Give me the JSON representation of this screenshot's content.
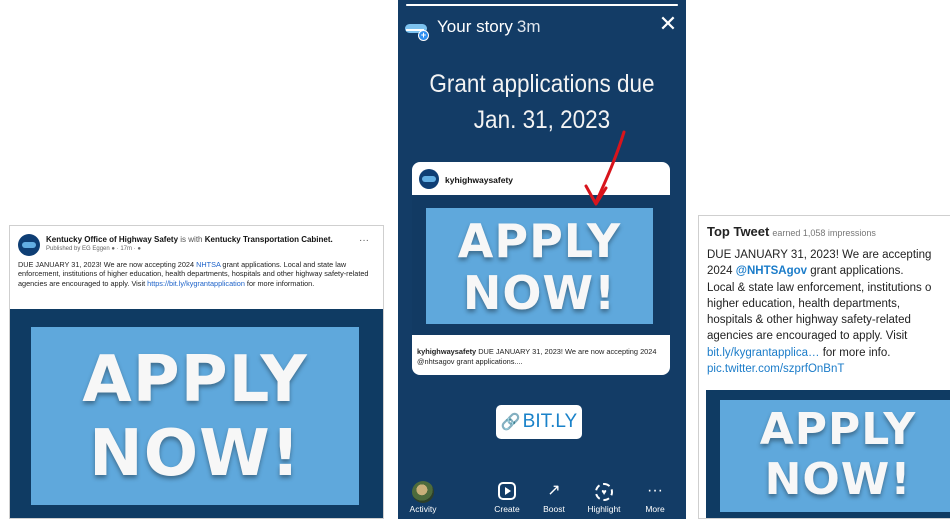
{
  "facebook_post": {
    "page_name": "Kentucky Office of Highway Safety",
    "with_text": "is with",
    "tagged": "Kentucky Transportation Cabinet.",
    "meta": "Published by EG Eggen ● · 17m · ●",
    "more": "···",
    "body_start": "DUE JANUARY 31, 2023! We are now accepting 2024 ",
    "body_link": "NHTSA",
    "body_mid": " grant applications.  Local and state law enforcement, institutions of higher education, health departments, hospitals and other highway safety-related agencies are encouraged to apply.  Visit ",
    "body_url": "https://bit.ly/kygrantapplication",
    "body_end": " for more information.",
    "image_line1": "APPLY",
    "image_line2": "NOW!"
  },
  "story": {
    "title": "Your story",
    "time": "3m",
    "close": "✕",
    "headline1": "Grant applications due",
    "headline2": "Jan. 31, 2023",
    "card": {
      "username": "kyhighwaysafety",
      "image_line1": "APPLY",
      "image_line2": "NOW!",
      "caption_user": "kyhighwaysafety",
      "caption_text": " DUE JANUARY 31, 2023! We are now accepting 2024 @nhtsagov grant applications...."
    },
    "link_sticker": "BIT.LY",
    "link_icon": "🔗",
    "nav": [
      {
        "label": "Activity",
        "icon": "activity-thumb"
      },
      {
        "label": "Create",
        "icon": "create-icon"
      },
      {
        "label": "Boost",
        "icon": "boost-icon"
      },
      {
        "label": "Highlight",
        "icon": "highlight-icon"
      },
      {
        "label": "More",
        "icon": "more-icon"
      }
    ]
  },
  "tweet": {
    "heading": "Top Tweet",
    "earned": "earned 1,058 impressions",
    "line1": "DUE JANUARY 31, 2023! We are accepting",
    "line2_pre": "2024 ",
    "line2_mention": "@NHTSAgov",
    "line2_post": " grant applications.",
    "line3": "Local & state law enforcement, institutions o",
    "line4": "higher education, health departments,",
    "line5": "hospitals & other highway safety-related",
    "line6": "agencies are encouraged to apply.  Visit",
    "line7_link": "bit.ly/kygrantapplica…",
    "line7_post": " for more info.",
    "line8_link": "pic.twitter.com/szprfOnBnT",
    "image_line1": "APPLY",
    "image_line2": "NOW!"
  },
  "colors": {
    "navy": "#133c66",
    "sky_panel": "#5fa8dc",
    "link_blue": "#1b7cc9",
    "arrow_red": "#d8141c"
  }
}
